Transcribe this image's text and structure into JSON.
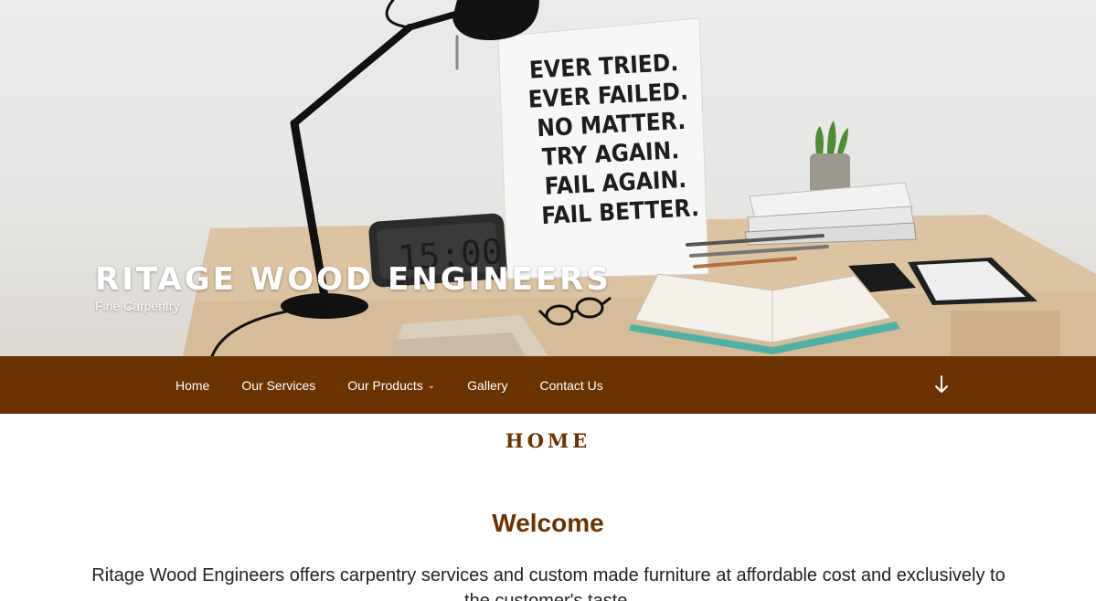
{
  "site": {
    "title": "RITAGE WOOD ENGINEERS",
    "tagline": "Fine Carpentry"
  },
  "hero": {
    "poster_lines": [
      "EVER TRIED.",
      "EVER FAILED.",
      "NO MATTER.",
      "TRY AGAIN.",
      "FAIL AGAIN.",
      "FAIL BETTER."
    ],
    "clock_display": "15:00"
  },
  "nav": {
    "items": [
      {
        "label": "Home"
      },
      {
        "label": "Our Services"
      },
      {
        "label": "Our Products",
        "has_dropdown": true
      },
      {
        "label": "Gallery"
      },
      {
        "label": "Contact Us"
      }
    ],
    "scroll_icon": "arrow-down-icon",
    "background_color": "#6b3302"
  },
  "page": {
    "heading": "HOME",
    "welcome": "Welcome",
    "intro": "Ritage Wood Engineers offers carpentry services and custom made furniture at affordable cost and exclusively to the customer's taste."
  },
  "colors": {
    "brand_brown": "#6b3302",
    "text_dark": "#222222"
  }
}
